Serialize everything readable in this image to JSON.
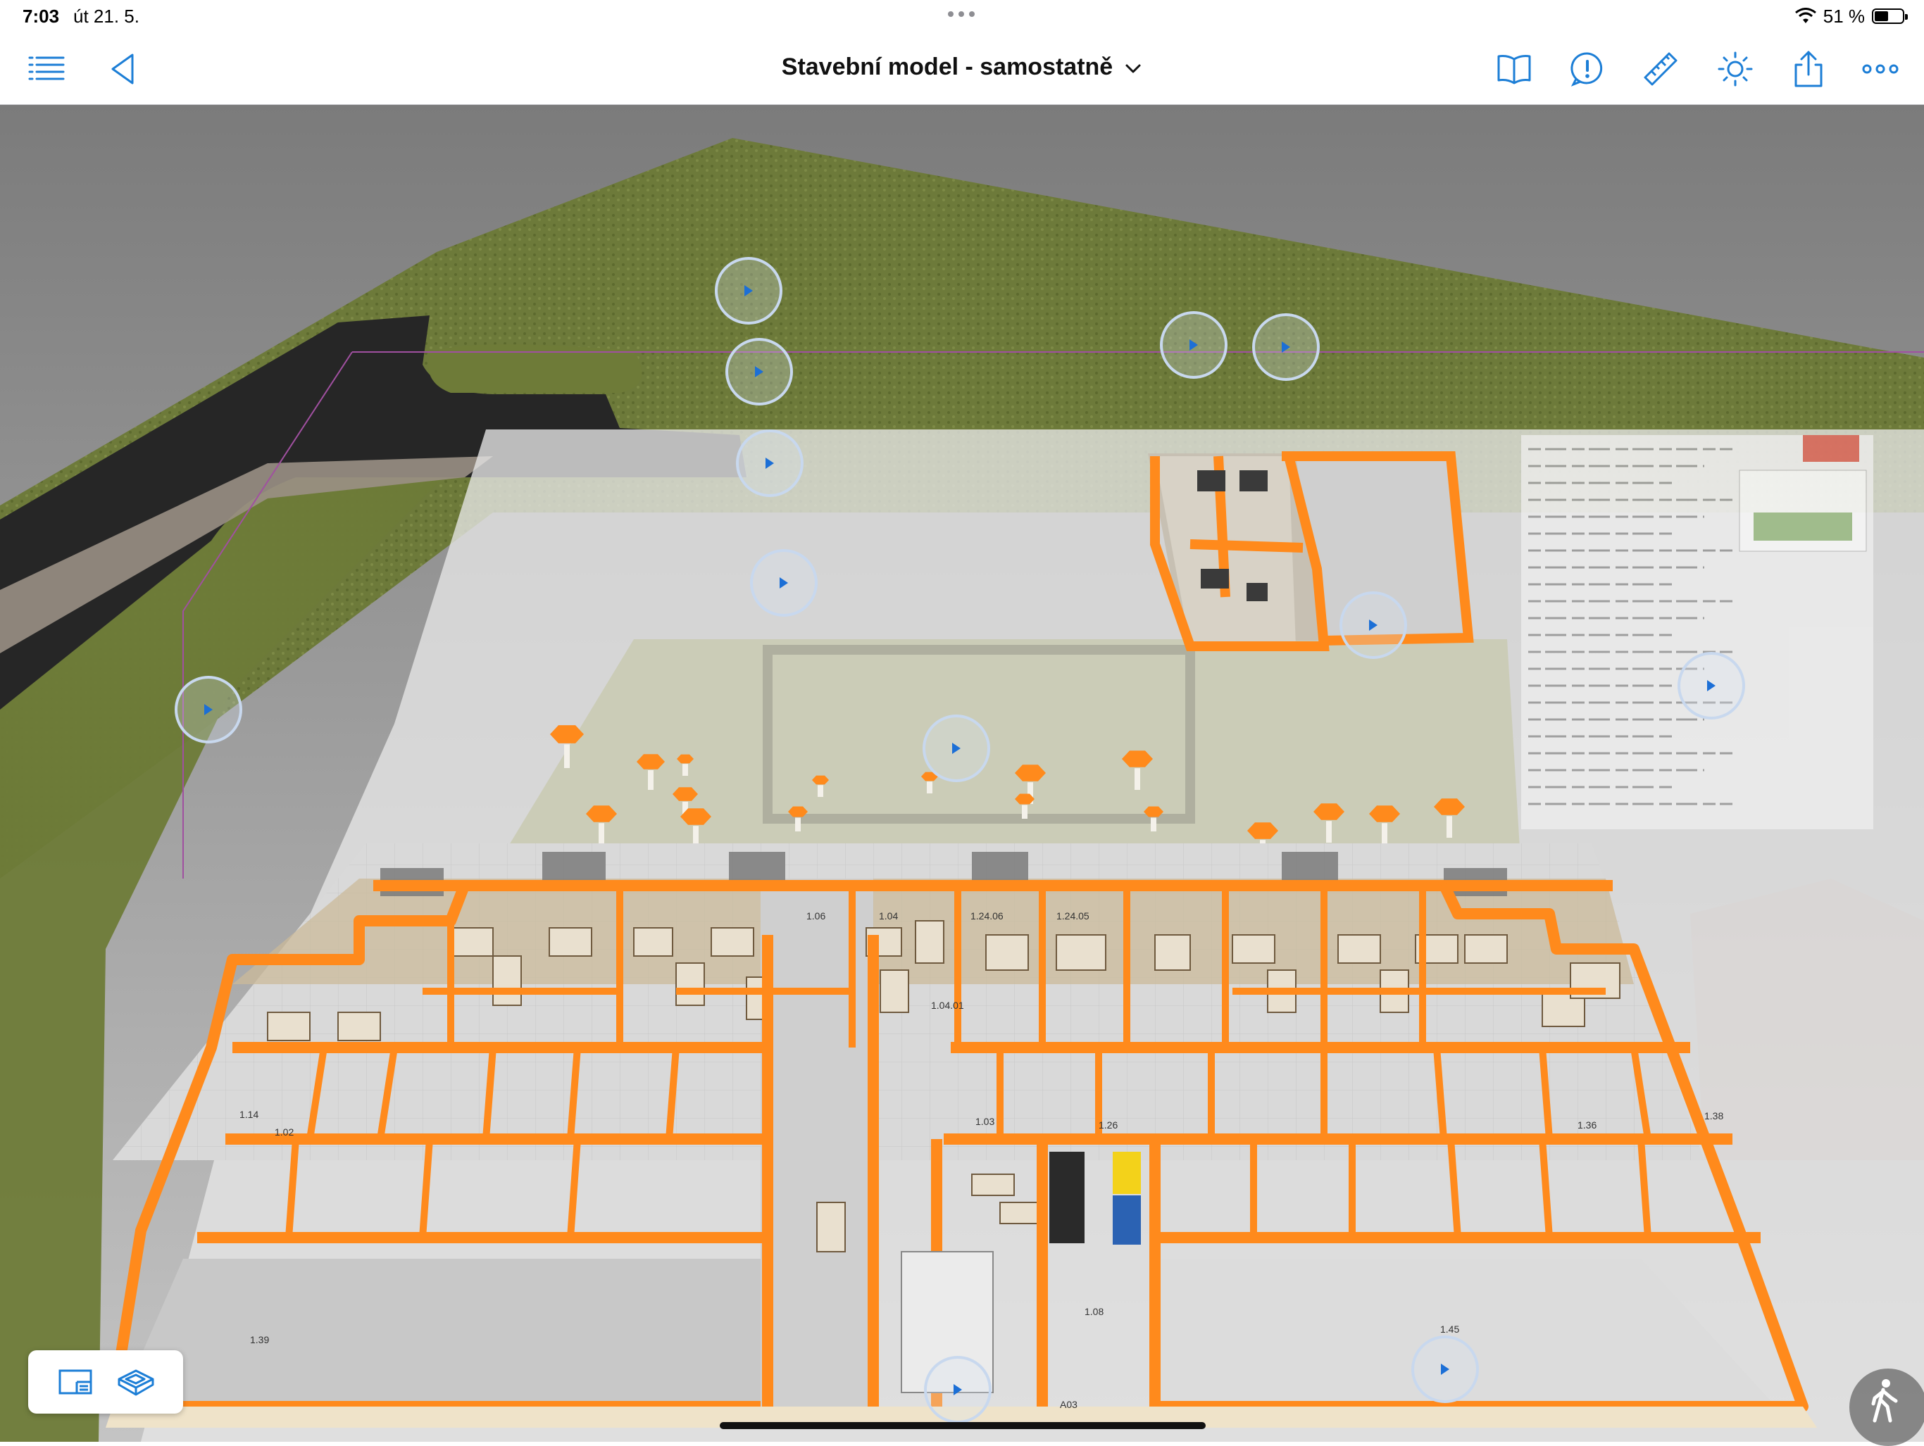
{
  "status_bar": {
    "time": "7:03",
    "date": "út 21. 5.",
    "battery_percent": "51 %",
    "battery_level": 0.51
  },
  "nav": {
    "title": "Stavební model - samostatně",
    "left_icons": [
      "list-icon",
      "back-triangle-icon"
    ],
    "right_icons": [
      "book-icon",
      "alert-icon",
      "ruler-icon",
      "sun-icon",
      "share-icon",
      "more-icon"
    ],
    "accent_color": "#1c7ed6"
  },
  "plan_labels": {
    "rooms": [
      "1.06",
      "1.04",
      "1.24.06",
      "1.24.05",
      "1.04.01",
      "1.14",
      "1.03",
      "1.26",
      "1.36",
      "1.38",
      "1.02",
      "1.39",
      "1.45",
      "A03",
      "1.08"
    ]
  },
  "bottom": {
    "mode_icons": [
      "sheet-view-icon",
      "model-3d-icon"
    ],
    "walk_icon": "walk-icon"
  }
}
